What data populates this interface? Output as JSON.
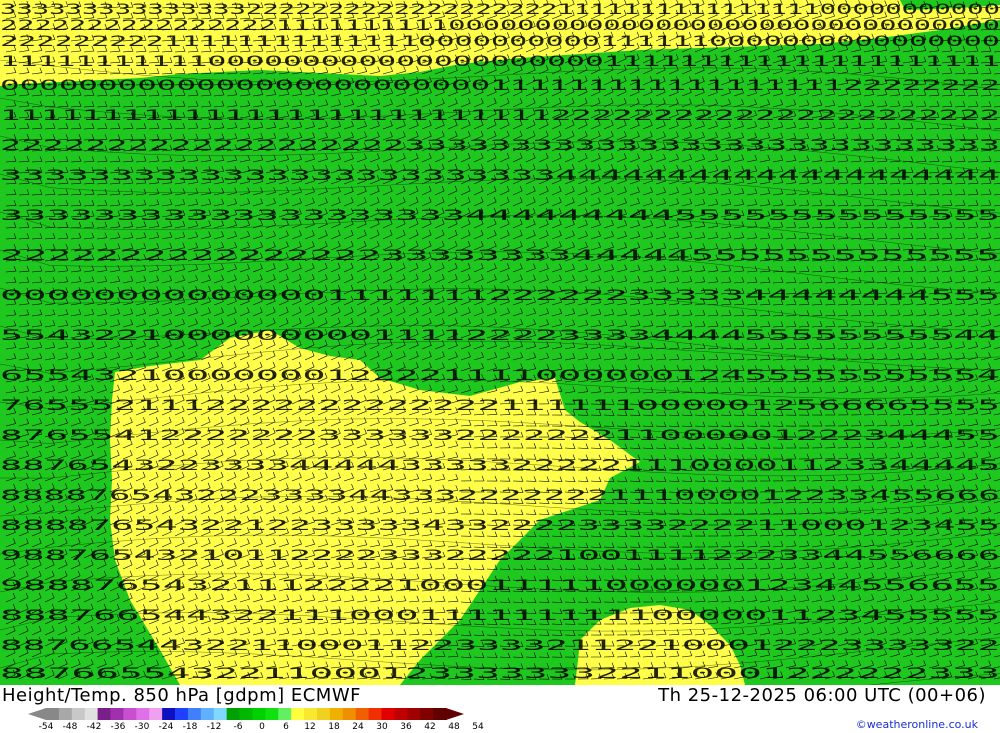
{
  "caption": {
    "title": "Height/Temp. 850 hPa [gdpm] ECMWF",
    "valid_time": "Th 25-12-2025 06:00 UTC (00+06)"
  },
  "credit": "©weatheronline.co.uk",
  "legend": {
    "tick_labels": [
      "-54",
      "-48",
      "-42",
      "-36",
      "-30",
      "-24",
      "-18",
      "-12",
      "-6",
      "0",
      "6",
      "12",
      "18",
      "24",
      "30",
      "36",
      "42",
      "48",
      "54"
    ],
    "colors": [
      "#888888",
      "#a8a8a8",
      "#c8c8c8",
      "#e0e0e0",
      "#7a1f8a",
      "#a030b0",
      "#c850d0",
      "#e070e8",
      "#f0a0f0",
      "#1010c0",
      "#2040ff",
      "#4080ff",
      "#60b0ff",
      "#80d8ff",
      "#00a000",
      "#00b800",
      "#00d000",
      "#10e010",
      "#60f060",
      "#ffff40",
      "#f8e830",
      "#f0d020",
      "#f0b000",
      "#f09000",
      "#f06000",
      "#f03000",
      "#e00000",
      "#c00000",
      "#a00000",
      "#800000",
      "#600000"
    ]
  },
  "map": {
    "field_colors": {
      "cool": "#1ec81e",
      "warm": "#ffff4a",
      "warmer": "#f4e83a"
    }
  }
}
